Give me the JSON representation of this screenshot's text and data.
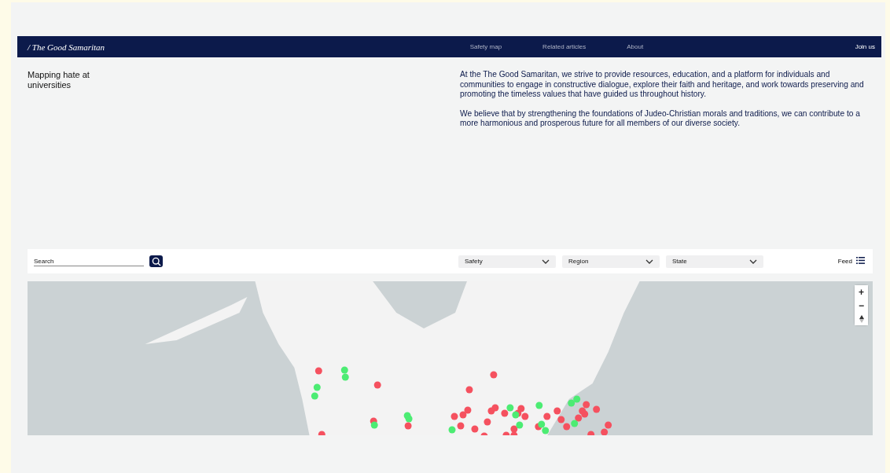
{
  "nav": {
    "brand": "/ The Good Samaritan",
    "links": [
      {
        "label": "Safety map"
      },
      {
        "label": "Related articles"
      },
      {
        "label": "About"
      }
    ],
    "cta": "Join us"
  },
  "intro": {
    "heading": "Mapping hate at universities",
    "paragraphs": [
      "At the The Good Samaritan, we strive to provide resources, education, and a platform for individuals and communities to engage in constructive dialogue, explore their faith and heritage, and work towards preserving and promoting the timeless values that have guided us throughout history.",
      "We believe that by strengthening the foundations of Judeo-Christian morals and traditions, we can contribute to a more harmonious and prosperous future for all members of our diverse society."
    ]
  },
  "filters": {
    "search": {
      "placeholder": "Search"
    },
    "dropdowns": [
      {
        "label": "Safety"
      },
      {
        "label": "Region"
      },
      {
        "label": "State"
      }
    ],
    "feed": "Feed"
  },
  "map": {
    "zoom_in": "+",
    "zoom_out": "−"
  }
}
